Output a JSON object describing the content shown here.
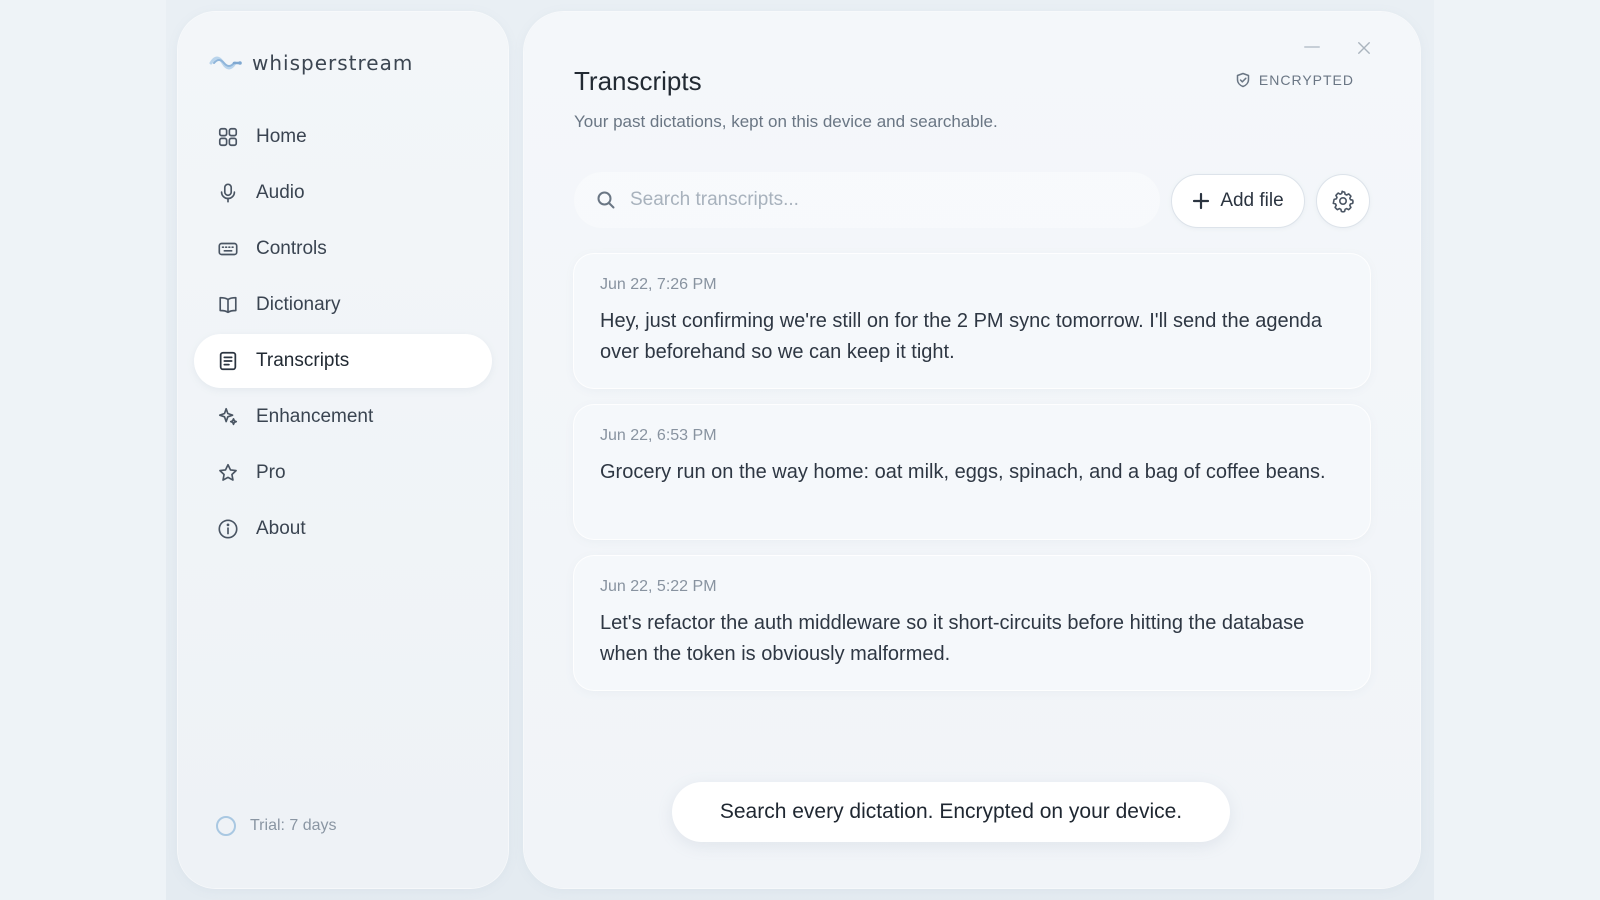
{
  "app": {
    "brand_name": "whisperstream"
  },
  "sidebar": {
    "items": [
      {
        "label": "Home",
        "icon": "grid-icon"
      },
      {
        "label": "Audio",
        "icon": "microphone-icon"
      },
      {
        "label": "Controls",
        "icon": "keyboard-icon"
      },
      {
        "label": "Dictionary",
        "icon": "book-icon"
      },
      {
        "label": "Transcripts",
        "icon": "document-icon",
        "active": true
      },
      {
        "label": "Enhancement",
        "icon": "sparkle-icon"
      },
      {
        "label": "Pro",
        "icon": "star-icon"
      },
      {
        "label": "About",
        "icon": "info-icon"
      }
    ],
    "trial_label": "Trial: 7 days"
  },
  "header": {
    "title": "Transcripts",
    "subtitle": "Your past dictations, kept on this device and searchable.",
    "badge": "ENCRYPTED"
  },
  "search": {
    "placeholder": "Search transcripts...",
    "value": ""
  },
  "toolbar": {
    "add_file_label": "Add file"
  },
  "transcripts": [
    {
      "time": "Jun 22, 7:26 PM",
      "text": "Hey, just confirming we're still on for the 2 PM sync tomorrow. I'll send the agenda over beforehand so we can keep it tight."
    },
    {
      "time": "Jun 22, 6:53 PM",
      "text": "Grocery run on the way home: oat milk, eggs, spinach, and a bag of coffee beans."
    },
    {
      "time": "Jun 22, 5:22 PM",
      "text": "Let's refactor the auth middleware so it short-circuits before hitting the database when the token is obviously malformed."
    }
  ],
  "toast": {
    "message": "Search every dictation. Encrypted on your device."
  },
  "colors": {
    "background": "#eef3f7",
    "panel": "#f3f6f9",
    "active_item": "#ffffff",
    "text_primary": "#222a33",
    "text_muted": "#8893a0",
    "trial_ring": "#a9c8e2",
    "logo_accent": "#9ec3e6"
  }
}
